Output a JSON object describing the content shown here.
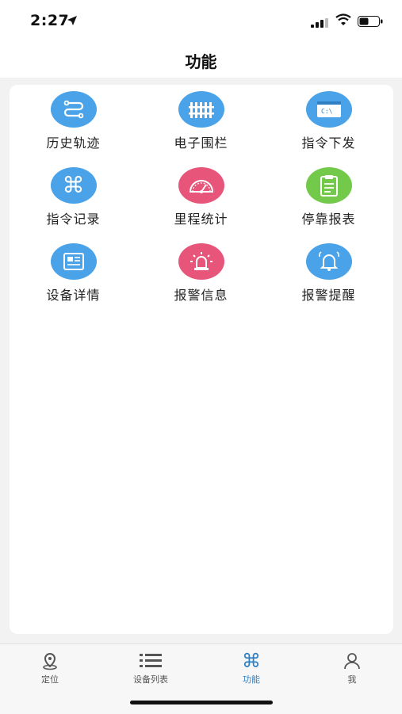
{
  "status_bar": {
    "time": "2:27"
  },
  "nav": {
    "title": "功能"
  },
  "tiles": [
    {
      "label": "历史轨迹",
      "icon": "route-icon",
      "color": "#4aa3e8"
    },
    {
      "label": "电子围栏",
      "icon": "fence-icon",
      "color": "#4aa3e8"
    },
    {
      "label": "指令下发",
      "icon": "terminal-icon",
      "color": "#4aa3e8"
    },
    {
      "label": "指令记录",
      "icon": "command-icon",
      "color": "#4aa3e8"
    },
    {
      "label": "里程统计",
      "icon": "speedometer-icon",
      "color": "#e8557a"
    },
    {
      "label": "停靠报表",
      "icon": "clipboard-icon",
      "color": "#72c94a"
    },
    {
      "label": "设备详情",
      "icon": "document-icon",
      "color": "#4aa3e8"
    },
    {
      "label": "报警信息",
      "icon": "alarm-light-icon",
      "color": "#e8557a"
    },
    {
      "label": "报警提醒",
      "icon": "bell-icon",
      "color": "#4aa3e8"
    }
  ],
  "tab_bar": {
    "tabs": [
      {
        "label": "定位",
        "icon": "location-icon",
        "active": false
      },
      {
        "label": "设备列表",
        "icon": "list-icon",
        "active": false
      },
      {
        "label": "功能",
        "icon": "command-icon",
        "active": true
      },
      {
        "label": "我",
        "icon": "person-icon",
        "active": false
      }
    ],
    "active_color": "#2f7fc2"
  }
}
